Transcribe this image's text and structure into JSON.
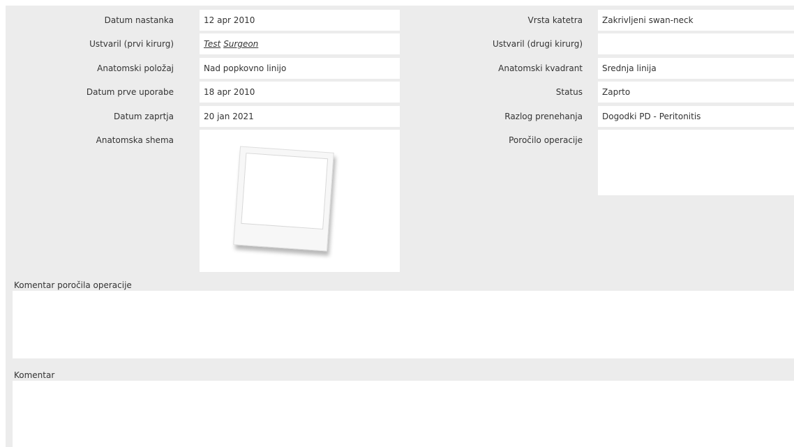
{
  "left_fields": [
    {
      "label": "Datum nastanka",
      "value": "12 apr 2010"
    },
    {
      "label": "Ustvaril (prvi kirurg)",
      "value": "",
      "links": [
        "Test",
        "Surgeon"
      ]
    },
    {
      "label": "Anatomski položaj",
      "value": "Nad popkovno linijo"
    },
    {
      "label": "Datum prve uporabe",
      "value": "18 apr 2010"
    },
    {
      "label": "Datum zaprtja",
      "value": "20 jan 2021"
    },
    {
      "label": "Anatomska shema"
    }
  ],
  "right_fields": [
    {
      "label": "Vrsta katetra",
      "value": "Zakrivljeni swan-neck"
    },
    {
      "label": "Ustvaril (drugi kirurg)",
      "value": ""
    },
    {
      "label": "Anatomski kvadrant",
      "value": "Srednja linija"
    },
    {
      "label": "Status",
      "value": "Zaprto"
    },
    {
      "label": "Razlog prenehanja",
      "value": "Dogodki PD - Peritonitis"
    },
    {
      "label": "Poročilo operacije",
      "value": ""
    }
  ],
  "sections": {
    "operation_report_comment": {
      "label": "Komentar poročila operacije",
      "value": ""
    },
    "comment": {
      "label": "Komentar",
      "value": ""
    }
  }
}
